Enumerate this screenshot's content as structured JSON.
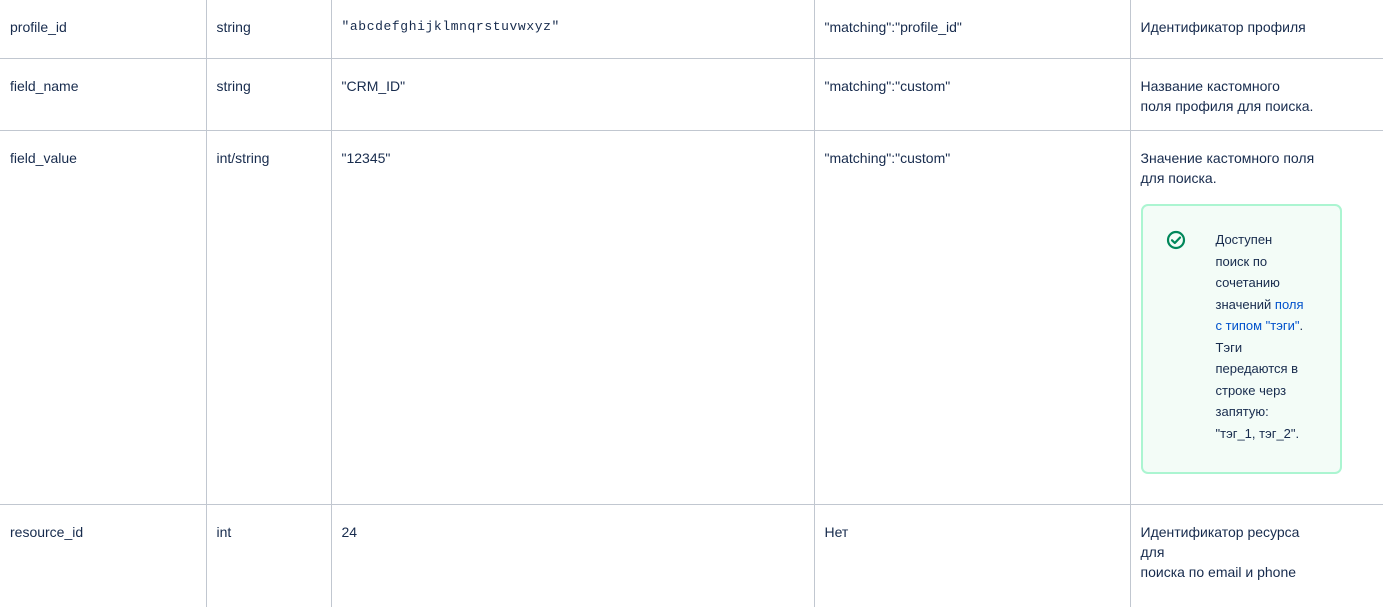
{
  "rows": [
    {
      "name": "profile_id",
      "type": "string",
      "example": "\"abcdefghijklmnqrstuvwxyz\"",
      "matching": "\"matching\":\"profile_id\"",
      "description": "Идентификатор профиля"
    },
    {
      "name": "field_name",
      "type": "string",
      "example": "\"CRM_ID\"",
      "matching": "\"matching\":\"custom\"",
      "description_lines": [
        "Название кастомного",
        "поля профиля для поиска."
      ]
    },
    {
      "name": "field_value",
      "type": "int/string",
      "example": "\"12345\"",
      "matching": "\"matching\":\"custom\"",
      "description_lines": [
        "Значение кастомного поля",
        "для поиска."
      ],
      "info_panel": {
        "icon": "check-circle-icon",
        "lines_before_link": [
          "Доступен",
          "поиск по",
          "сочетанию",
          "значений "
        ],
        "link_lines": [
          "поля",
          "с типом \"тэги\""
        ],
        "after_link": ".",
        "lines_after": [
          "Тэги",
          "передаются в",
          "строке черз",
          "запятую:",
          "\"тэг_1, тэг_2\"."
        ],
        "accent_color": "#00875a",
        "background_color": "#f3fcf7",
        "border_color": "#abf5d1",
        "link_color": "#0052cc"
      }
    },
    {
      "name": "resource_id",
      "type": "int",
      "example": "24",
      "matching": "Нет",
      "description_lines": [
        "Идентификатор ресурса",
        "для",
        "поиска по email и phone"
      ]
    }
  ]
}
